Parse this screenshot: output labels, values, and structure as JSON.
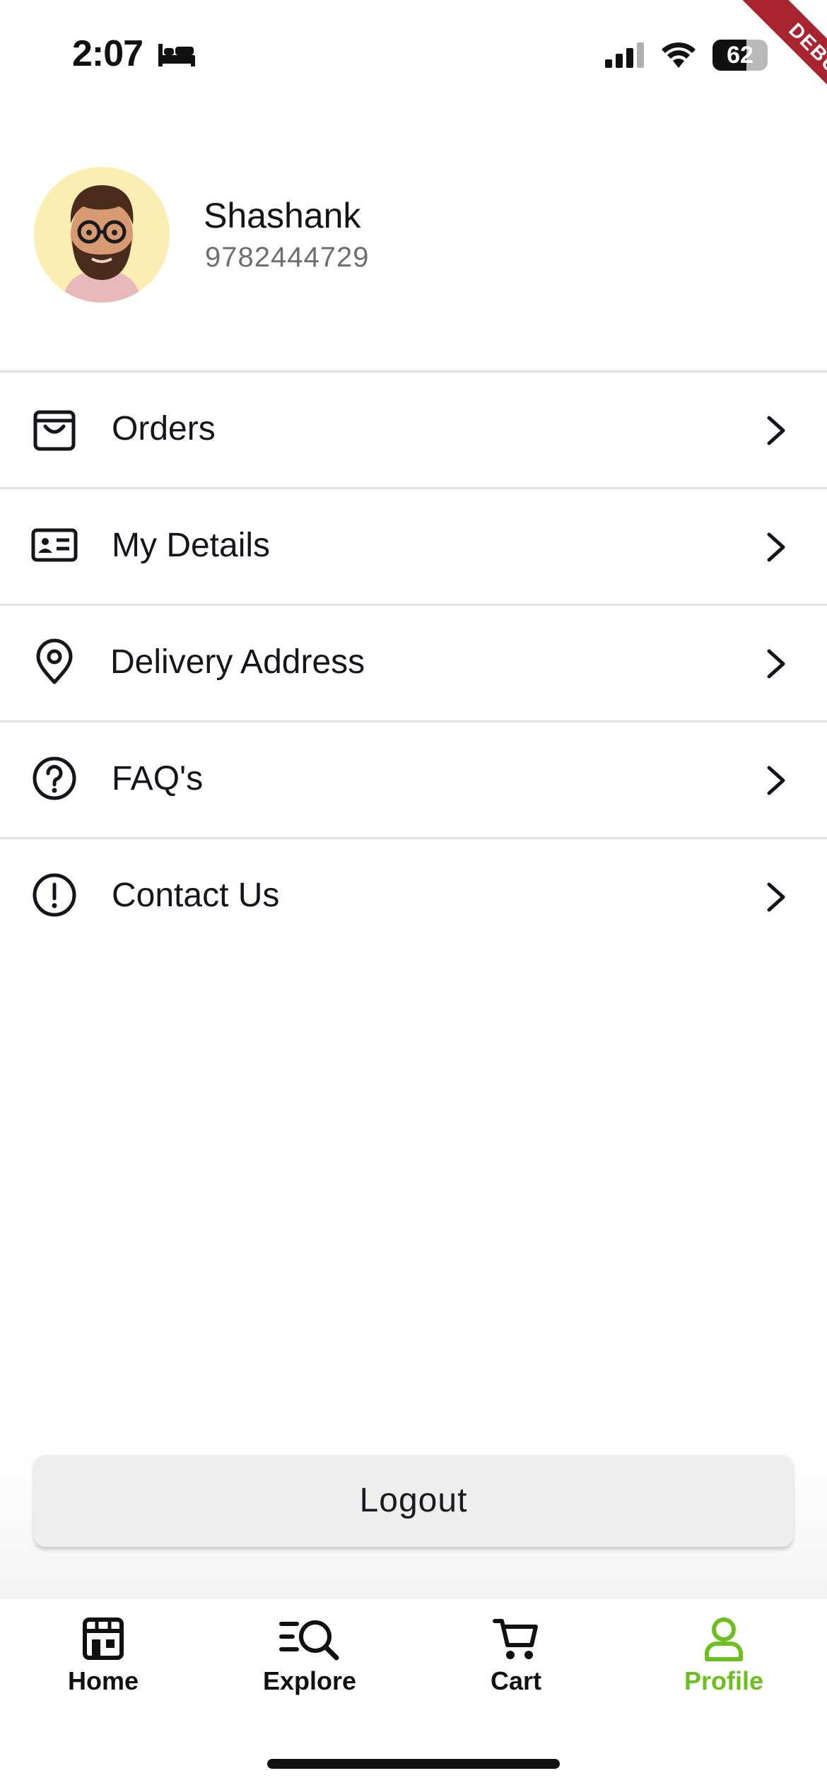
{
  "status_bar": {
    "time": "2:07",
    "battery": "62",
    "battery_level_percent": 62,
    "icons": [
      "bed-icon",
      "cellular-signal-icon",
      "wifi-icon",
      "battery-icon"
    ]
  },
  "debug_banner": "DEBUG",
  "profile": {
    "name": "Shashank",
    "phone": "9782444729",
    "avatar_icon": "bearded-man-avatar"
  },
  "menu": {
    "items": [
      {
        "label": "Orders",
        "icon": "shopping-bag-icon"
      },
      {
        "label": "My Details",
        "icon": "id-card-icon"
      },
      {
        "label": "Delivery Address",
        "icon": "location-pin-icon"
      },
      {
        "label": "FAQ's",
        "icon": "question-circle-icon"
      },
      {
        "label": "Contact Us",
        "icon": "info-circle-icon"
      }
    ]
  },
  "logout": {
    "label": "Logout"
  },
  "bottom_nav": {
    "items": [
      {
        "label": "Home",
        "icon": "store-icon",
        "active": false
      },
      {
        "label": "Explore",
        "icon": "explore-search-icon",
        "active": false
      },
      {
        "label": "Cart",
        "icon": "cart-icon",
        "active": false
      },
      {
        "label": "Profile",
        "icon": "user-icon",
        "active": true
      }
    ]
  },
  "colors": {
    "accent": "#6cbf1e",
    "debug_ribbon": "#a8242f",
    "text": "#15151b",
    "muted_text": "#6d6d72",
    "logout_bg": "#eeeeee",
    "avatar_bg": "#fbeeb2"
  }
}
